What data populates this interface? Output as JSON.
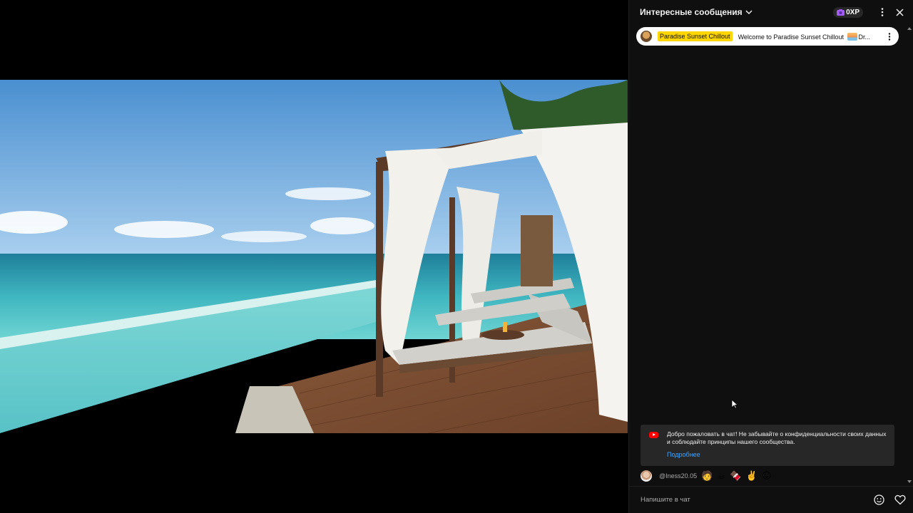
{
  "chat": {
    "title": "Интересные сообщения",
    "xp_label": "0XP",
    "pinned": {
      "author": "Paradise Sunset Chillout",
      "message_before": "Welcome to Paradise Sunset Chillout",
      "message_after": "Dr..."
    },
    "welcome": {
      "text": "Добро пожаловать в чат! Не забывайте о конфиденциальности своих данных и соблюдайте принципы нашего сообщества.",
      "link": "Подробнее"
    },
    "messages": [
      {
        "author": "@Iness20.05",
        "text": "🧑 ☕ 🍫 ✌️ 😛"
      }
    ],
    "input": {
      "placeholder": "Напишите в чат"
    }
  },
  "icons": {
    "title_chevron": "chevron-down-icon",
    "xp": "camera-badge-icon",
    "menu": "more-vert-icon",
    "close": "close-icon",
    "emoji": "smile-icon",
    "heart": "heart-icon"
  },
  "colors": {
    "chat_bg": "#0f0f0f",
    "pinned_author_bg": "#ffd600",
    "link": "#3ea6ff",
    "yt_red": "#ff0000",
    "xp_icon": "#a35cf5"
  }
}
